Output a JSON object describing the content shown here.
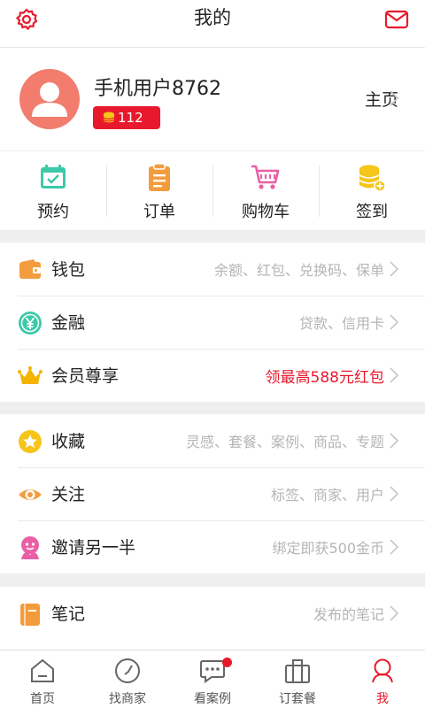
{
  "header": {
    "title": "我的"
  },
  "profile": {
    "username": "手机用户8762",
    "coins": "112",
    "homepage_label": "主页"
  },
  "quick_actions": [
    {
      "label": "预约",
      "icon": "calendar-icon",
      "color": "#3cc9a8"
    },
    {
      "label": "订单",
      "icon": "clipboard-icon",
      "color": "#f39c3d"
    },
    {
      "label": "购物车",
      "icon": "shopping-cart-icon",
      "color": "#e95fa5"
    },
    {
      "label": "签到",
      "icon": "coin-stack-icon",
      "color": "#f5c518"
    }
  ],
  "menu_groups": [
    [
      {
        "label": "钱包",
        "desc": "余额、红包、兑换码、保单",
        "icon": "wallet-icon"
      },
      {
        "label": "金融",
        "desc": "贷款、信用卡",
        "icon": "yen-icon"
      },
      {
        "label": "会员尊享",
        "desc": "领最高588元红包",
        "icon": "crown-icon",
        "highlight": true
      }
    ],
    [
      {
        "label": "收藏",
        "desc": "灵感、套餐、案例、商品、专题",
        "icon": "star-icon"
      },
      {
        "label": "关注",
        "desc": "标签、商家、用户",
        "icon": "eye-icon"
      },
      {
        "label": "邀请另一半",
        "desc": "绑定即获500金币",
        "icon": "couple-icon"
      }
    ],
    [
      {
        "label": "笔记",
        "desc": "发布的笔记",
        "icon": "notebook-icon"
      }
    ]
  ],
  "tabbar": [
    {
      "label": "首页",
      "icon": "home-icon"
    },
    {
      "label": "找商家",
      "icon": "compass-icon"
    },
    {
      "label": "看案例",
      "icon": "chat-bubble-icon",
      "badge": true
    },
    {
      "label": "订套餐",
      "icon": "package-icon"
    },
    {
      "label": "我",
      "icon": "person-icon",
      "active": true
    }
  ],
  "colors": {
    "accent": "#e8192c",
    "avatar_bg": "#f27c6e"
  }
}
